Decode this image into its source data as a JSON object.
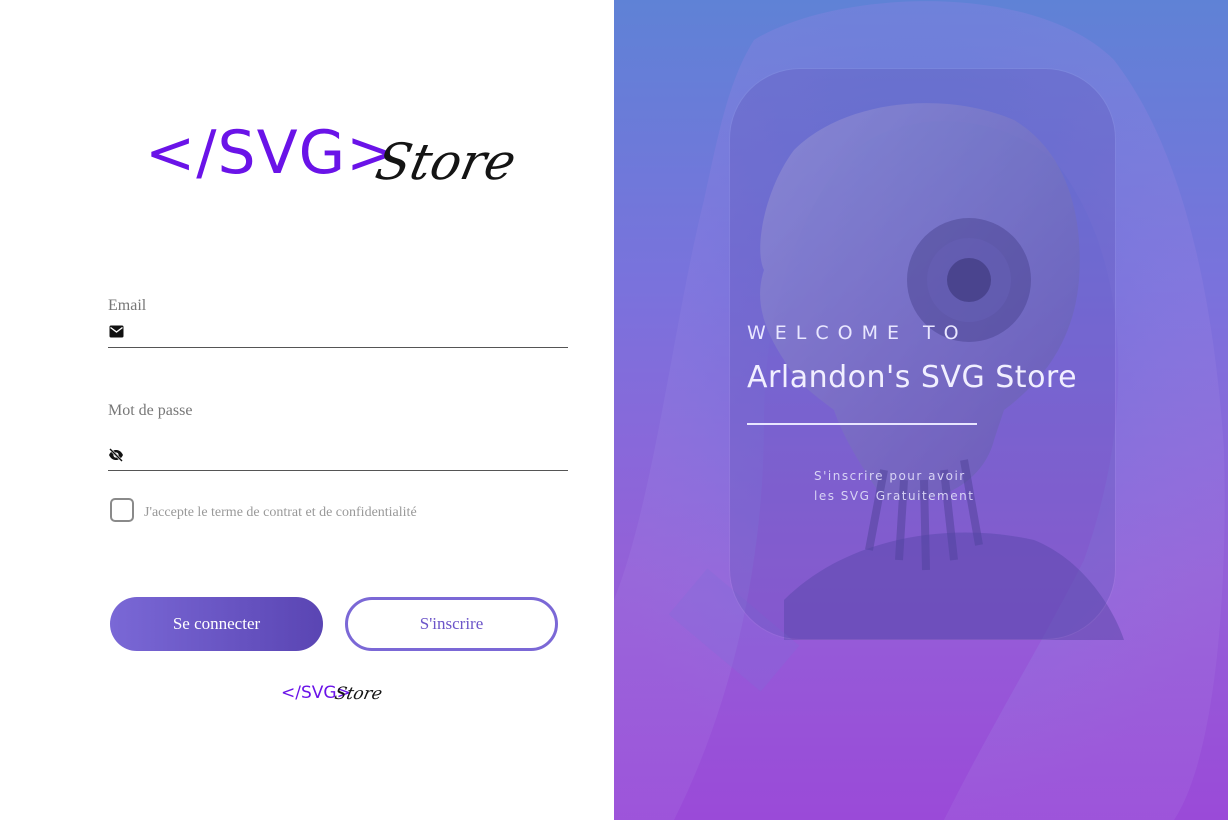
{
  "brand": {
    "code_text": "</SVG>",
    "store_text": "Store"
  },
  "form": {
    "email": {
      "label": "Email",
      "value": "",
      "icon": "mail-icon"
    },
    "password": {
      "label": "Mot de passe",
      "value": "",
      "icon": "eye-off-icon"
    },
    "terms_label": "J'accepte le terme de contrat et de confidentialité",
    "terms_checked": false
  },
  "buttons": {
    "login_label": "Se connecter",
    "signup_label": "S'inscrire"
  },
  "hero": {
    "welcome": "WELCOME TO",
    "title": "Arlandon's SVG Store",
    "tagline_line1": "S'inscrire pour avoir",
    "tagline_line2": "les SVG Gratuitement"
  },
  "colors": {
    "brand_purple": "#6a13e8",
    "button_purple": "#7a68d6",
    "hero_top": "#5f82d6",
    "hero_bottom": "#9a4ad8"
  }
}
